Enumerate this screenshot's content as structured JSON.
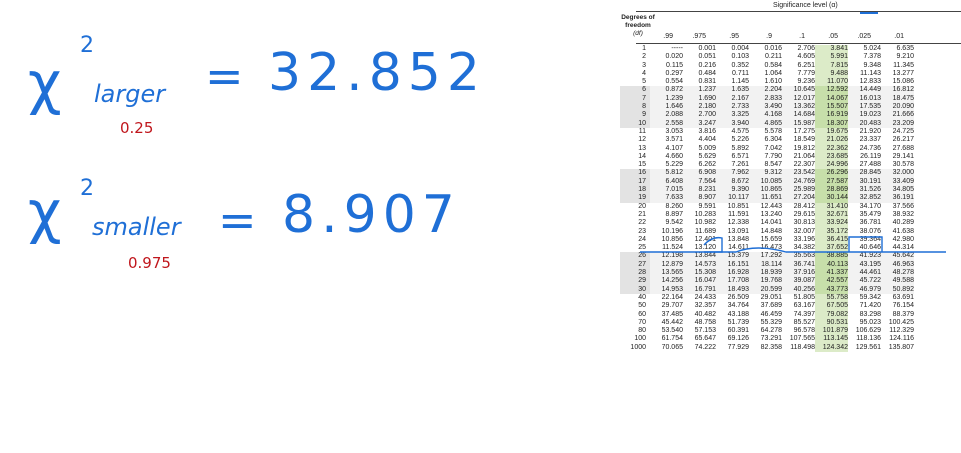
{
  "notes": {
    "larger": {
      "chi": "χ",
      "sup": "2",
      "sub": "larger",
      "eq": "=",
      "value": "32.852",
      "prob": "0.25"
    },
    "smaller": {
      "chi": "χ",
      "sup": "2",
      "sub": "smaller",
      "eq": "=",
      "value": "8.907",
      "prob": "0.975"
    }
  },
  "table": {
    "title": "Significance level (α)",
    "df_header": [
      "Degrees of",
      "freedom",
      "(df)"
    ],
    "alphas": [
      ".99",
      ".975",
      ".95",
      ".9",
      ".1",
      ".05",
      ".025",
      ".01"
    ],
    "rows": [
      [
        "1",
        "-----",
        "0.001",
        "0.004",
        "0.016",
        "2.706",
        "3.841",
        "5.024",
        "6.635"
      ],
      [
        "2",
        "0.020",
        "0.051",
        "0.103",
        "0.211",
        "4.605",
        "5.991",
        "7.378",
        "9.210"
      ],
      [
        "3",
        "0.115",
        "0.216",
        "0.352",
        "0.584",
        "6.251",
        "7.815",
        "9.348",
        "11.345"
      ],
      [
        "4",
        "0.297",
        "0.484",
        "0.711",
        "1.064",
        "7.779",
        "9.488",
        "11.143",
        "13.277"
      ],
      [
        "5",
        "0.554",
        "0.831",
        "1.145",
        "1.610",
        "9.236",
        "11.070",
        "12.833",
        "15.086"
      ],
      [
        "6",
        "0.872",
        "1.237",
        "1.635",
        "2.204",
        "10.645",
        "12.592",
        "14.449",
        "16.812"
      ],
      [
        "7",
        "1.239",
        "1.690",
        "2.167",
        "2.833",
        "12.017",
        "14.067",
        "16.013",
        "18.475"
      ],
      [
        "8",
        "1.646",
        "2.180",
        "2.733",
        "3.490",
        "13.362",
        "15.507",
        "17.535",
        "20.090"
      ],
      [
        "9",
        "2.088",
        "2.700",
        "3.325",
        "4.168",
        "14.684",
        "16.919",
        "19.023",
        "21.666"
      ],
      [
        "10",
        "2.558",
        "3.247",
        "3.940",
        "4.865",
        "15.987",
        "18.307",
        "20.483",
        "23.209"
      ],
      [
        "11",
        "3.053",
        "3.816",
        "4.575",
        "5.578",
        "17.275",
        "19.675",
        "21.920",
        "24.725"
      ],
      [
        "12",
        "3.571",
        "4.404",
        "5.226",
        "6.304",
        "18.549",
        "21.026",
        "23.337",
        "26.217"
      ],
      [
        "13",
        "4.107",
        "5.009",
        "5.892",
        "7.042",
        "19.812",
        "22.362",
        "24.736",
        "27.688"
      ],
      [
        "14",
        "4.660",
        "5.629",
        "6.571",
        "7.790",
        "21.064",
        "23.685",
        "26.119",
        "29.141"
      ],
      [
        "15",
        "5.229",
        "6.262",
        "7.261",
        "8.547",
        "22.307",
        "24.996",
        "27.488",
        "30.578"
      ],
      [
        "16",
        "5.812",
        "6.908",
        "7.962",
        "9.312",
        "23.542",
        "26.296",
        "28.845",
        "32.000"
      ],
      [
        "17",
        "6.408",
        "7.564",
        "8.672",
        "10.085",
        "24.769",
        "27.587",
        "30.191",
        "33.409"
      ],
      [
        "18",
        "7.015",
        "8.231",
        "9.390",
        "10.865",
        "25.989",
        "28.869",
        "31.526",
        "34.805"
      ],
      [
        "19",
        "7.633",
        "8.907",
        "10.117",
        "11.651",
        "27.204",
        "30.144",
        "32.852",
        "36.191"
      ],
      [
        "20",
        "8.260",
        "9.591",
        "10.851",
        "12.443",
        "28.412",
        "31.410",
        "34.170",
        "37.566"
      ],
      [
        "21",
        "8.897",
        "10.283",
        "11.591",
        "13.240",
        "29.615",
        "32.671",
        "35.479",
        "38.932"
      ],
      [
        "22",
        "9.542",
        "10.982",
        "12.338",
        "14.041",
        "30.813",
        "33.924",
        "36.781",
        "40.289"
      ],
      [
        "23",
        "10.196",
        "11.689",
        "13.091",
        "14.848",
        "32.007",
        "35.172",
        "38.076",
        "41.638"
      ],
      [
        "24",
        "10.856",
        "12.401",
        "13.848",
        "15.659",
        "33.196",
        "36.415",
        "39.364",
        "42.980"
      ],
      [
        "25",
        "11.524",
        "13.120",
        "14.611",
        "16.473",
        "34.382",
        "37.652",
        "40.646",
        "44.314"
      ],
      [
        "26",
        "12.198",
        "13.844",
        "15.379",
        "17.292",
        "35.563",
        "38.885",
        "41.923",
        "45.642"
      ],
      [
        "27",
        "12.879",
        "14.573",
        "16.151",
        "18.114",
        "36.741",
        "40.113",
        "43.195",
        "46.963"
      ],
      [
        "28",
        "13.565",
        "15.308",
        "16.928",
        "18.939",
        "37.916",
        "41.337",
        "44.461",
        "48.278"
      ],
      [
        "29",
        "14.256",
        "16.047",
        "17.708",
        "19.768",
        "39.087",
        "42.557",
        "45.722",
        "49.588"
      ],
      [
        "30",
        "14.953",
        "16.791",
        "18.493",
        "20.599",
        "40.256",
        "43.773",
        "46.979",
        "50.892"
      ],
      [
        "40",
        "22.164",
        "24.433",
        "26.509",
        "29.051",
        "51.805",
        "55.758",
        "59.342",
        "63.691"
      ],
      [
        "50",
        "29.707",
        "32.357",
        "34.764",
        "37.689",
        "63.167",
        "67.505",
        "71.420",
        "76.154"
      ],
      [
        "60",
        "37.485",
        "40.482",
        "43.188",
        "46.459",
        "74.397",
        "79.082",
        "83.298",
        "88.379"
      ],
      [
        "70",
        "45.442",
        "48.758",
        "51.739",
        "55.329",
        "85.527",
        "90.531",
        "95.023",
        "100.425"
      ],
      [
        "80",
        "53.540",
        "57.153",
        "60.391",
        "64.278",
        "96.578",
        "101.879",
        "106.629",
        "112.329"
      ],
      [
        "100",
        "61.754",
        "65.647",
        "69.126",
        "73.291",
        "107.565",
        "113.145",
        "118.136",
        "124.116"
      ],
      [
        "1000",
        "70.065",
        "74.222",
        "77.929",
        "82.358",
        "118.498",
        "124.342",
        "129.561",
        "135.807"
      ]
    ]
  },
  "colors": {
    "ink_blue": "#1f6fd6",
    "ink_red": "#c0161c",
    "green_col": "#dcebc8",
    "row_shade": "#e3e3e3"
  }
}
